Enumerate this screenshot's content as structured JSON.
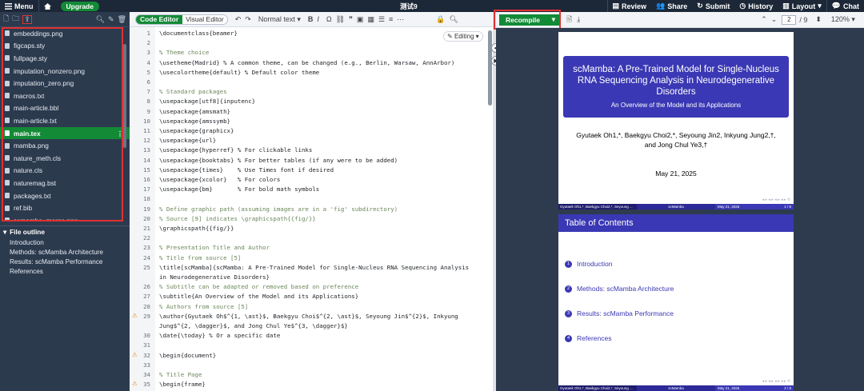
{
  "topbar": {
    "menu_label": "Menu",
    "upgrade_label": "Upgrade",
    "project_title": "测试9",
    "review_label": "Review",
    "share_label": "Share",
    "submit_label": "Submit",
    "history_label": "History",
    "layout_label": "Layout",
    "chat_label": "Chat"
  },
  "files": [
    {
      "name": "embeddings.png",
      "active": false
    },
    {
      "name": "figcaps.sty",
      "active": false
    },
    {
      "name": "fullpage.sty",
      "active": false
    },
    {
      "name": "imputation_nonzero.png",
      "active": false
    },
    {
      "name": "imputation_zero.png",
      "active": false
    },
    {
      "name": "macros.txt",
      "active": false
    },
    {
      "name": "main-article.bbl",
      "active": false
    },
    {
      "name": "main-article.txt",
      "active": false
    },
    {
      "name": "main.tex",
      "active": true
    },
    {
      "name": "mamba.png",
      "active": false
    },
    {
      "name": "nature_meth.cls",
      "active": false
    },
    {
      "name": "nature.cls",
      "active": false
    },
    {
      "name": "naturemag.bst",
      "active": false
    },
    {
      "name": "packages.txt",
      "active": false
    },
    {
      "name": "ref.bib",
      "active": false
    },
    {
      "name": "scmamba_merge.png",
      "active": false
    }
  ],
  "outline": {
    "title": "File outline",
    "items": [
      "Introduction",
      "Methods: scMamba Architecture",
      "Results: scMamba Performance",
      "References"
    ]
  },
  "editor": {
    "code_editor_label": "Code Editor",
    "visual_editor_label": "Visual Editor",
    "style_select": "Normal text",
    "editing_label": "Editing",
    "lines": [
      {
        "n": 1,
        "text": "\\documentclass{beamer}",
        "warn": false
      },
      {
        "n": 2,
        "text": "",
        "warn": false
      },
      {
        "n": 3,
        "text": "% Theme choice",
        "warn": false
      },
      {
        "n": 4,
        "text": "\\usetheme{Madrid} % A common theme, can be changed (e.g., Berlin, Warsaw, AnnArbor)",
        "warn": false
      },
      {
        "n": 5,
        "text": "\\usecolortheme{default} % Default color theme",
        "warn": false
      },
      {
        "n": 6,
        "text": "",
        "warn": false
      },
      {
        "n": 7,
        "text": "% Standard packages",
        "warn": false
      },
      {
        "n": 8,
        "text": "\\usepackage[utf8]{inputenc}",
        "warn": false
      },
      {
        "n": 9,
        "text": "\\usepackage{amsmath}",
        "warn": false
      },
      {
        "n": 10,
        "text": "\\usepackage{amssymb}",
        "warn": false
      },
      {
        "n": 11,
        "text": "\\usepackage{graphicx}",
        "warn": false
      },
      {
        "n": 12,
        "text": "\\usepackage{url}",
        "warn": false
      },
      {
        "n": 13,
        "text": "\\usepackage{hyperref} % For clickable links",
        "warn": false
      },
      {
        "n": 14,
        "text": "\\usepackage{booktabs} % For better tables (if any were to be added)",
        "warn": false
      },
      {
        "n": 15,
        "text": "\\usepackage{times}    % Use Times font if desired",
        "warn": false
      },
      {
        "n": 16,
        "text": "\\usepackage{xcolor}   % For colors",
        "warn": false
      },
      {
        "n": 17,
        "text": "\\usepackage{bm}       % For bold math symbols",
        "warn": false
      },
      {
        "n": 18,
        "text": "",
        "warn": false
      },
      {
        "n": 19,
        "text": "% Define graphic path (assuming images are in a 'fig' subdirectory)",
        "warn": false
      },
      {
        "n": 20,
        "text": "% Source [9] indicates \\graphicspath{{fig/}}",
        "warn": false
      },
      {
        "n": 21,
        "text": "\\graphicspath{{fig/}}",
        "warn": false
      },
      {
        "n": 22,
        "text": "",
        "warn": false
      },
      {
        "n": 23,
        "text": "% Presentation Title and Author",
        "warn": false
      },
      {
        "n": 24,
        "text": "% Title from source [5]",
        "warn": false
      },
      {
        "n": 25,
        "text": "\\title[scMamba]{scMamba: A Pre-Trained Model for Single-Nucleus RNA Sequencing Analysis",
        "warn": false
      },
      {
        "n": "",
        "text": "in Neurodegenerative Disorders}",
        "warn": false
      },
      {
        "n": 26,
        "text": "% Subtitle can be adapted or removed based on preference",
        "warn": false
      },
      {
        "n": 27,
        "text": "\\subtitle{An Overview of the Model and its Applications}",
        "warn": false
      },
      {
        "n": 28,
        "text": "% Authors from source [5]",
        "warn": false
      },
      {
        "n": 29,
        "text": "\\author{Gyutaek Oh$^{1, \\ast}$, Baekgyu Choi$^{2, \\ast}$, Seyoung Jin$^{2}$, Inkyung",
        "warn": true
      },
      {
        "n": "",
        "text": "Jung$^{2, \\dagger}$, and Jong Chul Ye$^{3, \\dagger}$}",
        "warn": false
      },
      {
        "n": 30,
        "text": "\\date{\\today} % Or a specific date",
        "warn": false
      },
      {
        "n": 31,
        "text": "",
        "warn": false
      },
      {
        "n": 32,
        "text": "\\begin{document}",
        "warn": true
      },
      {
        "n": 33,
        "text": "",
        "warn": false
      },
      {
        "n": 34,
        "text": "% Title Page",
        "warn": false
      },
      {
        "n": 35,
        "text": "\\begin{frame}",
        "warn": true
      }
    ]
  },
  "pdf": {
    "recompile_label": "Recompile",
    "page_current": "2",
    "page_total": "/ 9",
    "zoom": "120%",
    "slide1": {
      "title": "scMamba: A Pre-Trained Model for Single-Nucleus RNA Sequencing Analysis in Neurodegenerative Disorders",
      "subtitle": "An Overview of the Model and its Applications",
      "authors_line1": "Gyutaek Oh1,*, Baekgyu Choi2,*, Seyoung Jin2, Inkyung Jung2,†,",
      "authors_line2": "and Jong Chul Ye3,†",
      "date": "May 21, 2025",
      "footer_left": "Gyutaek Oh1,*, Baekgyu Choi2,*, Seyoung ...",
      "footer_mid": "scMamba",
      "footer_date": "May 21, 2025",
      "footer_page": "1 / 8"
    },
    "slide2": {
      "heading": "Table of Contents",
      "items": [
        "Introduction",
        "Methods: scMamba Architecture",
        "Results: scMamba Performance",
        "References"
      ],
      "footer_left": "Gyutaek Oh1,*, Baekgyu Choi2,*, Seyoung ...",
      "footer_mid": "scMamba",
      "footer_date": "May 21, 2025",
      "footer_page": "2 / 8"
    }
  },
  "colors": {
    "accent": "#138a36",
    "beamer": "#3a38b4",
    "highlight": "#e03131"
  }
}
